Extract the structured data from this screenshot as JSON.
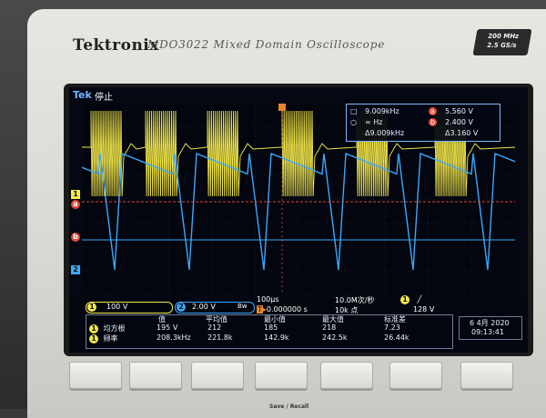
{
  "device": {
    "brand": "Tektronix",
    "model": "MDO3022 Mixed Domain Oscilloscope",
    "spec_line1": "200 MHz",
    "spec_line2": "2.5 GS/s"
  },
  "topbar": {
    "logo": "Tek",
    "status": "停止"
  },
  "cursor_readout": {
    "a_freq": "9.009kHz",
    "a_volt": "5.560 V",
    "b_freq": "∞ Hz",
    "b_volt": "2.400 V",
    "delta_freq": "Δ9.009kHz",
    "delta_volt": "Δ3.160 V",
    "marker_a": "a",
    "marker_b": "b"
  },
  "channels": {
    "ch1_marker": "1",
    "ch2_marker": "2",
    "ref_a": "a",
    "ref_b": "b",
    "ch1_scale": "100 V",
    "ch2_scale": "2.00 V",
    "ch2_suffix": "Bw"
  },
  "timebase": {
    "per_div": "100μs",
    "trigger_pos": "0.000000 s",
    "sample_rate": "10.0M次/秒",
    "record_length": "10k 点",
    "trigger_ch": "1",
    "trigger_level": "128 V",
    "trigger_slope": "╱"
  },
  "measurements": {
    "headers": [
      "值",
      "平均值",
      "最小值",
      "最大值",
      "标准差"
    ],
    "rows": [
      {
        "ch": "1",
        "name": "均方根",
        "values": [
          "195 V",
          "212",
          "185",
          "218",
          "7.23"
        ]
      },
      {
        "ch": "1",
        "name": "频率",
        "values": [
          "208.3kHz",
          "221.8k",
          "142.9k",
          "242.5k",
          "26.44k"
        ]
      }
    ]
  },
  "datetime": {
    "date": "6 4月 2020",
    "time": "09:13:41"
  },
  "panel": {
    "save_recall": "Save / Recall"
  },
  "colors": {
    "ch1": "#f5e94a",
    "ch2": "#3aa8ff",
    "ref": "#e24a3a"
  }
}
